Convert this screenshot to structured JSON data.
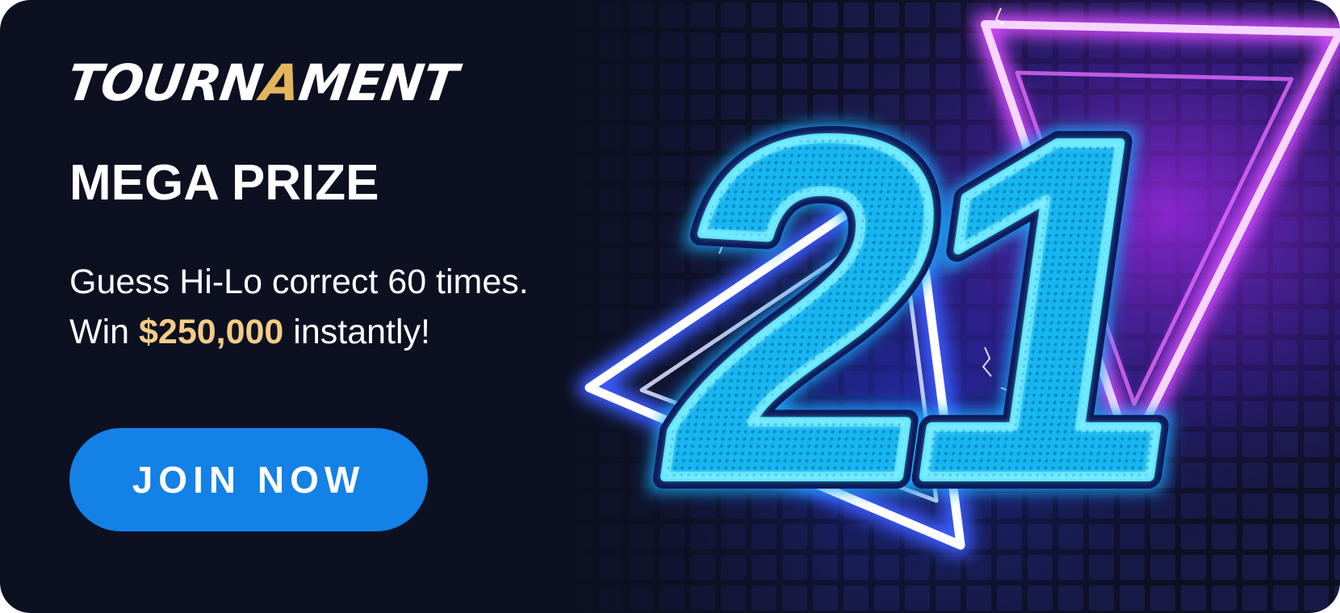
{
  "logo": {
    "part1": "TOURN",
    "highlight": "A",
    "part2": "MENT"
  },
  "title": "MEGA PRIZE",
  "description": {
    "line1": "Guess Hi-Lo correct 60 times.",
    "line2_prefix": "Win ",
    "amount": "$250,000",
    "line2_suffix": " instantly!"
  },
  "join_button": {
    "label": "JOIN NOW"
  },
  "graphic": {
    "number": "21"
  },
  "colors": {
    "background": "#0d1021",
    "accent_gold": "#e3b55c",
    "prize_gold": "#f3cc86",
    "button_blue": "#1381e6",
    "neon_cyan": "#2fd4ff",
    "neon_magenta": "#c13cff"
  }
}
